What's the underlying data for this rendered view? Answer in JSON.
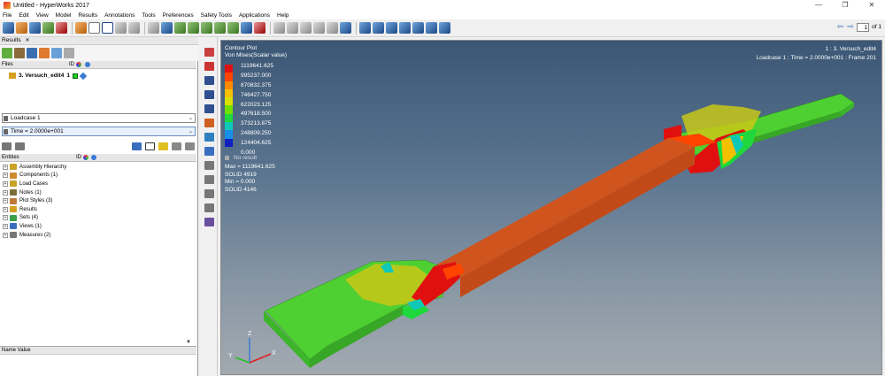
{
  "window": {
    "title": "Untitled - HyperWorks 2017",
    "controls": [
      "—",
      "❐",
      "✕"
    ]
  },
  "menu": [
    "File",
    "Edit",
    "View",
    "Model",
    "Results",
    "Annotations",
    "Tools",
    "Preferences",
    "Safety Tools",
    "Applications",
    "Help"
  ],
  "page_nav": {
    "current": "1",
    "total_label": "of 1"
  },
  "left_panel": {
    "tab_label": "Results",
    "tab_close": "✕",
    "files_header": {
      "files": "Files",
      "id": "ID"
    },
    "file_entry": {
      "name": "3. Versuch_edit4",
      "id": "1"
    },
    "loadcase_select": "Loadcase 1",
    "time_select": "Time = 2.0000e+001",
    "entities_header": {
      "entities": "Entities",
      "id": "ID"
    },
    "entities": [
      {
        "label": "Assembly Hierarchy",
        "icon_color": "#c9a227"
      },
      {
        "label": "Components (1)",
        "icon_color": "#d08a2a"
      },
      {
        "label": "Load Cases",
        "icon_color": "#c9a227"
      },
      {
        "label": "Notes (1)",
        "icon_color": "#7b6e3a"
      },
      {
        "label": "Plot Styles (3)",
        "icon_color": "#c07a3a"
      },
      {
        "label": "Results",
        "icon_color": "#d4a020"
      },
      {
        "label": "Sets (4)",
        "icon_color": "#3aa04a"
      },
      {
        "label": "Views (1)",
        "icon_color": "#3a6fc0"
      },
      {
        "label": "Measures (2)",
        "icon_color": "#777777"
      }
    ],
    "name_value_header": "Name Value"
  },
  "viewport": {
    "legend": {
      "title": "Contour Plot",
      "subtitle": "Von Mises(Scalar value)",
      "levels": [
        "1119641.625",
        "995237.000",
        "870832.375",
        "746427.750",
        "622023.125",
        "497618.500",
        "373213.875",
        "248809.250",
        "124404.625",
        "0.000"
      ],
      "colors": [
        "#e01010",
        "#ff4400",
        "#ff8a00",
        "#f5c000",
        "#d8e000",
        "#70e000",
        "#1ed83c",
        "#10c8b8",
        "#1890e8",
        "#1020c0"
      ],
      "no_result_label": "No result",
      "stats": [
        "Max = 1119641.625",
        "SOLID 4919",
        "Min = 0.000",
        "SOLID 4146"
      ]
    },
    "info_line1": "1 : 3. Versuch_edit4",
    "info_line2": "Loadcase 1 : Time = 2.0000e+001 : Frame 201",
    "axes": {
      "x": "X",
      "y": "Y",
      "z": "Z"
    },
    "colors": {
      "body": "#d0541e",
      "shoulder": "#4fd032",
      "hot": "#e01010",
      "warm": "#c8c818"
    }
  }
}
